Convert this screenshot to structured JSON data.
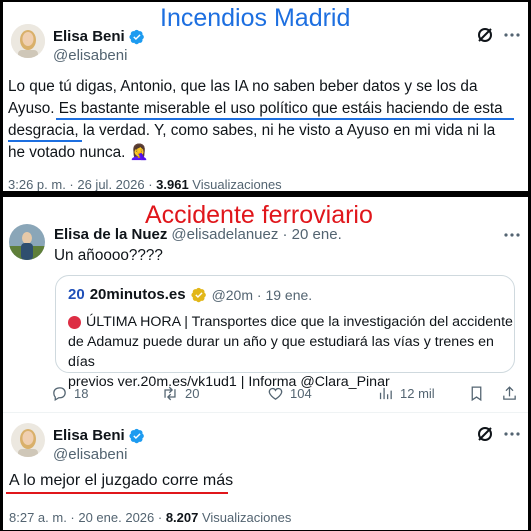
{
  "overlay": {
    "title_top": "Incendios Madrid",
    "title_middle": "Accidente ferroviario",
    "title_top_color": "#1d6fe0",
    "title_middle_color": "#e0161b",
    "underline_blue": "#1d6fe0",
    "underline_red": "#e0161b"
  },
  "tweet1": {
    "name": "Elisa Beni",
    "handle": "@elisabeni",
    "line1": "Lo que tú digas, Antonio, que las IA no saben beber datos y se los da",
    "line2": "Ayuso. Es bastante miserable el uso político que estáis haciendo de esta",
    "line3": "desgracia, la verdad. Y, como sabes, ni he visto a Ayuso en mi vida ni la",
    "line4": "he votado nunca. 🤦‍♀️",
    "time": "3:26 p. m. · 26 jul. 2026 · ",
    "views_count": "3.961",
    "views_label": " Visualizaciones"
  },
  "tweet2": {
    "name": "Elisa de la Nuez",
    "handle": "@elisadelanuez · 20 ene.",
    "text": "Un añoooo????",
    "quote": {
      "source_name": "20minutos.es",
      "source_handle": "@20m · 19 ene.",
      "line1": "ÚLTIMA HORA | Transportes dice que la investigación del accidente",
      "line2": "de Adamuz puede durar un año y que estudiará las vías y trenes en días",
      "line3": "previos ver.20m.es/vk1ud1 | Informa @Clara_Pinar"
    },
    "actions": {
      "replies": "18",
      "retweets": "20",
      "likes": "104",
      "views": "12 mil"
    }
  },
  "tweet3": {
    "name": "Elisa Beni",
    "handle": "@elisabeni",
    "text": "A lo mejor el juzgado corre más",
    "time": "8:27 a. m. · 20 ene. 2026 · ",
    "views_count": "8.207",
    "views_label": " Visualizaciones"
  }
}
